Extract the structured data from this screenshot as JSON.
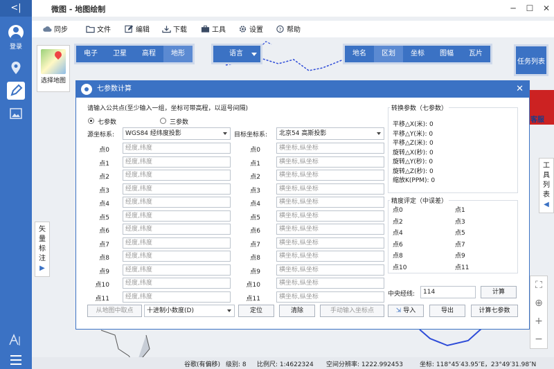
{
  "app": {
    "title": "微图 - 地图绘制"
  },
  "sidebar": {
    "login_label": "登录"
  },
  "toolbar": {
    "items": [
      {
        "label": "同步",
        "icon": "cloud-sync-icon"
      },
      {
        "label": "文件",
        "icon": "folder-icon"
      },
      {
        "label": "编辑",
        "icon": "edit-icon"
      },
      {
        "label": "下载",
        "icon": "download-icon"
      },
      {
        "label": "工具",
        "icon": "toolbox-icon"
      },
      {
        "label": "设置",
        "icon": "gear-icon"
      },
      {
        "label": "帮助",
        "icon": "help-icon"
      }
    ]
  },
  "map": {
    "chooser_label": "选择地图",
    "source_tabs": [
      "电子",
      "卫星",
      "高程",
      "地形"
    ],
    "source_selected": "地形",
    "language_label": "语言",
    "overlay_tabs": [
      "地名",
      "区划",
      "坐标",
      "图幅",
      "瓦片"
    ],
    "overlay_selected": "区划",
    "task_list_label": "任务列表",
    "tools_list_label": "工具列表",
    "vector_label": "矢量标注",
    "customer_service_label": "客服"
  },
  "dialog": {
    "title": "七参数计算",
    "instruction": "请输入公共点(至少输入一组，坐标可带高程，以逗号间隔)",
    "mode_seven": "七参数",
    "mode_three": "三参数",
    "source_label": "源坐标系:",
    "source_value": "WGS84 经纬度投影",
    "target_label": "目标坐标系:",
    "target_value": "北京54 高斯投影",
    "point_labels": [
      "点0",
      "点1",
      "点2",
      "点3",
      "点4",
      "点5",
      "点6",
      "点7",
      "点8",
      "点9",
      "点10",
      "点11"
    ],
    "source_placeholder": "经度,纬度",
    "target_placeholder": "横坐标,纵坐标",
    "params_title": "转换参数（七参数）",
    "params": [
      "平移△X(米): 0",
      "平移△Y(米): 0",
      "平移△Z(米): 0",
      "旋转△X(秒): 0",
      "旋转△Y(秒): 0",
      "旋转△Z(秒): 0",
      "缩放K(PPM): 0"
    ],
    "accuracy_title": "精度评定（中误差）",
    "accuracy_points": [
      "点0",
      "点1",
      "点2",
      "点3",
      "点4",
      "点5",
      "点6",
      "点7",
      "点8",
      "点9",
      "点10",
      "点11"
    ],
    "central_meridian_label": "中央经线:",
    "central_meridian_value": "114",
    "calc_button": "计算",
    "btn_pick_from_map": "从地图中取点",
    "number_format": "十进制小数度(D)",
    "btn_locate": "定位",
    "btn_clear": "清除",
    "btn_manual_input": "手动输入坐标点",
    "btn_import": "导入",
    "btn_export": "导出",
    "btn_calc_seven": "计算七参数"
  },
  "status": {
    "provider": "谷歌(有偏移)",
    "level": "级别: 8",
    "scale": "比例尺: 1:4622324",
    "resolution": "空间分辨率: 1222.992453",
    "coords": "坐标: 118°45′43.95″E，23°49′31.98″N"
  },
  "colors": {
    "accent": "#3b72c4",
    "panel_border": "#cfd9ea"
  }
}
